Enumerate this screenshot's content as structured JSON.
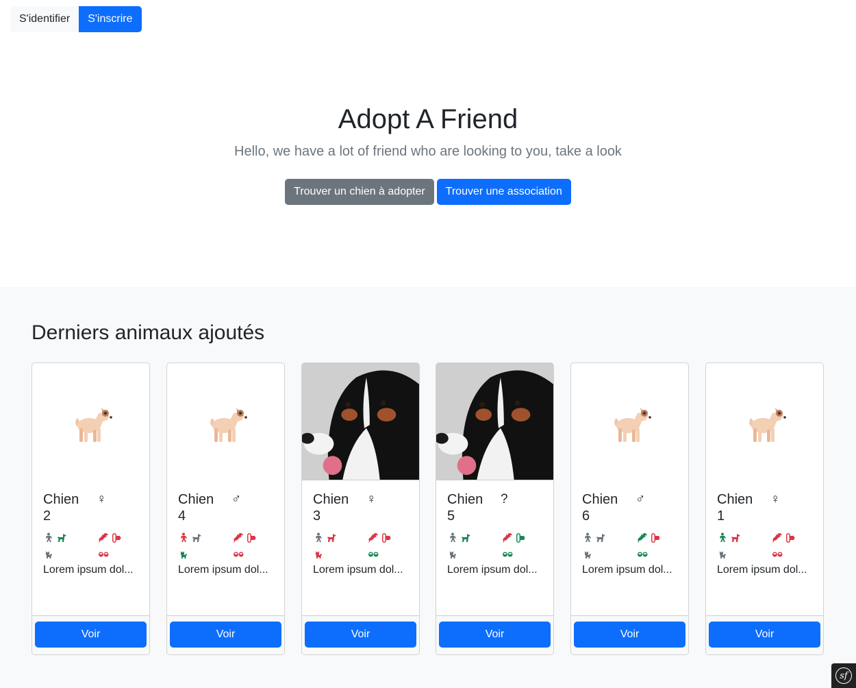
{
  "auth": {
    "login_label": "S'identifier",
    "register_label": "S'inscrire"
  },
  "hero": {
    "title": "Adopt A Friend",
    "lead": "Hello, we have a lot of friend who are looking to you, take a look",
    "btn_find_dog": "Trouver un chien à adopter",
    "btn_find_assoc": "Trouver une association"
  },
  "latest": {
    "heading": "Derniers animaux ajoutés",
    "cards": [
      {
        "name": "Chien 2",
        "sex": "♀",
        "image": "dog-emoji",
        "desc": "Lorem ipsum dol...",
        "button": "Voir",
        "child": "gray",
        "dog": "green",
        "vaccine": "red",
        "sterile": "red",
        "cat": "gray",
        "pills": "red"
      },
      {
        "name": "Chien 4",
        "sex": "♂",
        "image": "dog-emoji",
        "desc": "Lorem ipsum dol...",
        "button": "Voir",
        "child": "red",
        "dog": "gray",
        "vaccine": "red",
        "sterile": "red",
        "cat": "green",
        "pills": "red"
      },
      {
        "name": "Chien 3",
        "sex": "♀",
        "image": "dog-photo",
        "desc": "Lorem ipsum dol...",
        "button": "Voir",
        "child": "gray",
        "dog": "red",
        "vaccine": "red",
        "sterile": "red",
        "cat": "red",
        "pills": "green"
      },
      {
        "name": "Chien 5",
        "sex": "?",
        "image": "dog-photo",
        "desc": "Lorem ipsum dol...",
        "button": "Voir",
        "child": "gray",
        "dog": "green",
        "vaccine": "red",
        "sterile": "green",
        "cat": "gray",
        "pills": "green"
      },
      {
        "name": "Chien 6",
        "sex": "♂",
        "image": "dog-emoji",
        "desc": "Lorem ipsum dol...",
        "button": "Voir",
        "child": "gray",
        "dog": "gray",
        "vaccine": "green",
        "sterile": "red",
        "cat": "gray",
        "pills": "green"
      },
      {
        "name": "Chien 1",
        "sex": "♀",
        "image": "dog-emoji",
        "desc": "Lorem ipsum dol...",
        "button": "Voir",
        "child": "green",
        "dog": "red",
        "vaccine": "red",
        "sterile": "red",
        "cat": "gray",
        "pills": "red"
      }
    ]
  },
  "colors": {
    "primary": "#0d6efd",
    "secondary": "#6c757d",
    "success": "#198754",
    "danger": "#dc3545",
    "light": "#f8f9fa"
  }
}
